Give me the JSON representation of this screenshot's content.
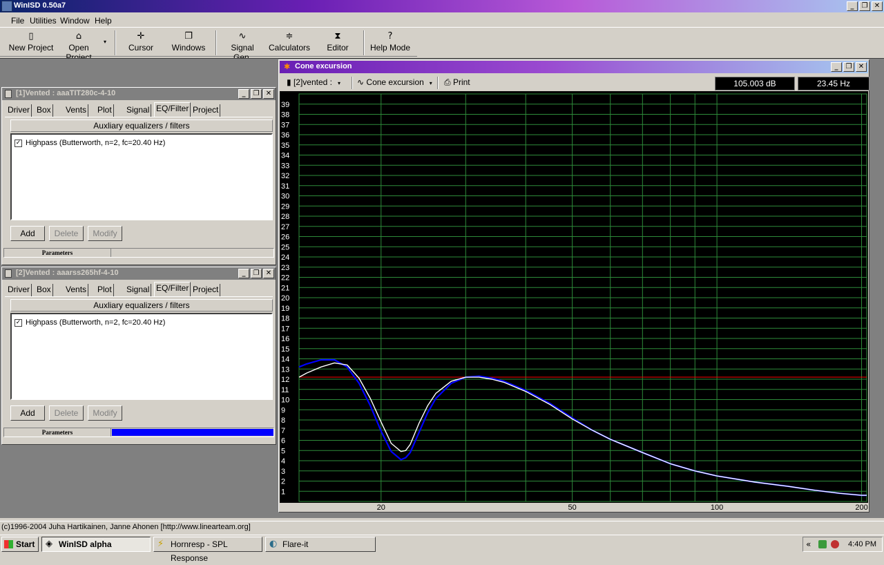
{
  "app": {
    "title": "WinISD 0.50a7"
  },
  "caption_buttons": {
    "minimize": "_",
    "restore": "❐",
    "close": "✕"
  },
  "menu": [
    "File",
    "Utilities",
    "Window",
    "Help"
  ],
  "toolbar": [
    {
      "label": "New Project",
      "icon": "new-project-icon",
      "glyph": "▯"
    },
    {
      "label": "Open Project",
      "icon": "open-folder-icon",
      "glyph": "⌂"
    },
    {
      "label": "Cursor",
      "icon": "cursor-icon",
      "glyph": "✛"
    },
    {
      "label": "Windows",
      "icon": "windows-icon",
      "glyph": "❐"
    },
    {
      "label": "Signal Gen.",
      "icon": "sine-wave-icon",
      "glyph": "∿"
    },
    {
      "label": "Calculators",
      "icon": "calculator-icon",
      "glyph": "≑"
    },
    {
      "label": "Editor",
      "icon": "editor-icon",
      "glyph": "⧗"
    },
    {
      "label": "Help Mode",
      "icon": "help-icon",
      "glyph": "?"
    }
  ],
  "toolbar_dropdown_arrow": "▾",
  "projects": [
    {
      "title": "[1]Vented : aaaTIT280c-4-10",
      "tabs": [
        "Driver",
        "Box",
        "Vents",
        "Plot",
        "Signal",
        "EQ/Filter",
        "Project"
      ],
      "active_tab": "EQ/Filter",
      "section_header": "Auxliary equalizers / filters",
      "filters": [
        {
          "checked": true,
          "label": "Highpass (Butterworth, n=2, fc=20.40 Hz)"
        }
      ],
      "buttons": [
        "Add",
        "Delete",
        "Modify"
      ],
      "params_label": "Parameters",
      "params_progress": 0
    },
    {
      "title": "[2]Vented : aaarss265hf-4-10",
      "tabs": [
        "Driver",
        "Box",
        "Vents",
        "Plot",
        "Signal",
        "EQ/Filter",
        "Project"
      ],
      "active_tab": "EQ/Filter",
      "section_header": "Auxliary equalizers / filters",
      "filters": [
        {
          "checked": true,
          "label": "Highpass (Butterworth, n=2, fc=20.40 Hz)"
        }
      ],
      "buttons": [
        "Add",
        "Delete",
        "Modify"
      ],
      "params_label": "Parameters",
      "params_progress": 1
    }
  ],
  "cone_window": {
    "title": "Cone excursion",
    "project_select": "[2]vented :",
    "graph_select": "Cone excursion",
    "print_label": "Print",
    "readout_db": "105.003 dB",
    "readout_hz": "23.45 Hz",
    "checkmark": "✓"
  },
  "chart_data": {
    "type": "line",
    "x_scale": "log",
    "xlim": [
      13.5,
      205
    ],
    "ylim": [
      0,
      40
    ],
    "x_ticks": [
      20,
      50,
      100,
      200
    ],
    "y_ticks": [
      1,
      2,
      3,
      4,
      5,
      6,
      7,
      8,
      9,
      10,
      11,
      12,
      13,
      14,
      15,
      16,
      17,
      18,
      19,
      20,
      21,
      22,
      23,
      24,
      25,
      26,
      27,
      28,
      29,
      30,
      31,
      32,
      33,
      34,
      35,
      36,
      37,
      38,
      39
    ],
    "grid": true,
    "grid_color": "#2e8b3a",
    "reference_line": {
      "y": 12.2,
      "color": "#ff0000"
    },
    "series": [
      {
        "color": "#0000ff",
        "x": [
          13.5,
          14,
          15,
          16,
          17,
          18,
          19,
          20,
          21,
          22,
          22.5,
          23,
          24,
          25,
          26,
          28,
          30,
          32,
          34,
          36,
          40,
          45,
          50,
          55,
          60,
          70,
          80,
          90,
          100,
          120,
          140,
          160,
          180,
          200,
          205
        ],
        "y": [
          13.2,
          13.5,
          13.9,
          13.9,
          13.2,
          11.6,
          9.4,
          6.9,
          4.9,
          4.1,
          4.3,
          4.8,
          6.8,
          8.7,
          10.1,
          11.6,
          12.2,
          12.3,
          12.1,
          11.8,
          10.9,
          9.6,
          8.2,
          7.0,
          6.1,
          4.8,
          3.7,
          3.0,
          2.5,
          1.9,
          1.5,
          1.1,
          0.8,
          0.6,
          0.6
        ]
      },
      {
        "color": "#ffffff",
        "x": [
          13.5,
          14,
          15,
          16,
          17,
          18,
          19,
          20,
          21,
          22,
          22.5,
          23,
          24,
          25,
          26,
          28,
          30,
          32,
          34,
          36,
          40,
          45,
          50,
          55,
          60,
          70,
          80,
          90,
          100,
          120,
          140,
          160,
          180,
          200,
          205
        ],
        "y": [
          12.2,
          12.6,
          13.2,
          13.6,
          13.4,
          12.1,
          10.1,
          7.8,
          5.7,
          4.9,
          5.0,
          5.6,
          7.7,
          9.4,
          10.6,
          11.8,
          12.2,
          12.2,
          12.0,
          11.7,
          10.8,
          9.5,
          8.1,
          7.0,
          6.1,
          4.8,
          3.7,
          3.0,
          2.5,
          1.9,
          1.5,
          1.1,
          0.8,
          0.6,
          0.6
        ]
      }
    ]
  },
  "status_text": "(c)1996-2004 Juha Hartikainen, Janne Ahonen [http://www.linearteam.org]",
  "taskbar": {
    "start_label": "Start",
    "items": [
      {
        "label": "WinISD alpha",
        "active": true,
        "icon": "winisd-icon",
        "glyph": "◈"
      },
      {
        "label": "Hornresp - SPL Response",
        "active": false,
        "icon": "lightning-icon",
        "glyph": "⚡"
      },
      {
        "label": "Flare-it",
        "active": false,
        "icon": "flare-it-icon",
        "glyph": "◐"
      }
    ],
    "tray_chevron": "«",
    "clock": "4:40 PM"
  }
}
